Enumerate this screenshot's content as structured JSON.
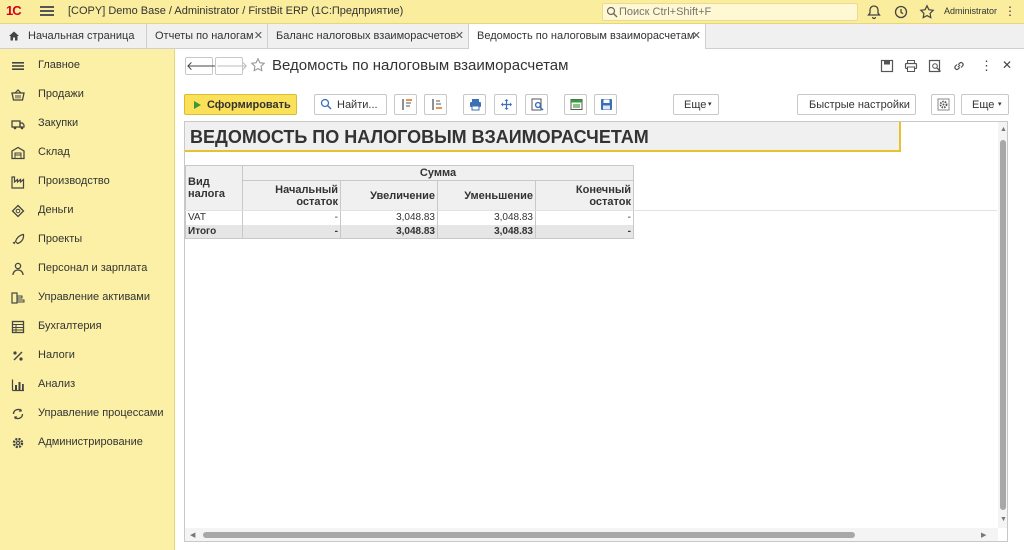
{
  "app": {
    "logo": "1С",
    "title": "[COPY] Demo Base / Administrator / FirstBit ERP  (1С:Предприятие)",
    "search_placeholder": "Поиск Ctrl+Shift+F",
    "user": "Administrator"
  },
  "tabs": [
    {
      "label": "Начальная страница",
      "closable": false
    },
    {
      "label": "Отчеты по налогам",
      "closable": true
    },
    {
      "label": "Баланс налоговых взаиморасчетов",
      "closable": true
    },
    {
      "label": "Ведомость по налоговым взаиморасчетам",
      "closable": true,
      "active": true
    }
  ],
  "sidebar": {
    "items": [
      {
        "label": "Главное",
        "icon": "menu-lines-icon"
      },
      {
        "label": "Продажи",
        "icon": "basket-icon"
      },
      {
        "label": "Закупки",
        "icon": "truck-icon"
      },
      {
        "label": "Склад",
        "icon": "warehouse-icon"
      },
      {
        "label": "Производство",
        "icon": "factory-icon"
      },
      {
        "label": "Деньги",
        "icon": "coins-icon"
      },
      {
        "label": "Проекты",
        "icon": "rocket-icon"
      },
      {
        "label": "Персонал и зарплата",
        "icon": "person-icon"
      },
      {
        "label": "Управление активами",
        "icon": "assets-icon"
      },
      {
        "label": "Бухгалтерия",
        "icon": "ledger-icon"
      },
      {
        "label": "Налоги",
        "icon": "percent-icon"
      },
      {
        "label": "Анализ",
        "icon": "bar-chart-icon"
      },
      {
        "label": "Управление процессами",
        "icon": "process-icon"
      },
      {
        "label": "Администрирование",
        "icon": "gear-icon"
      }
    ]
  },
  "form": {
    "title": "Ведомость по налоговым взаиморасчетам"
  },
  "toolbar": {
    "generate_label": "Сформировать",
    "find_label": "Найти...",
    "more_label": "Еще",
    "quick_settings_label": "Быстрые настройки",
    "more2_label": "Еще"
  },
  "report": {
    "heading": "ВЕДОМОСТЬ ПО НАЛОГОВЫМ ВЗАИМОРАСЧЕТАМ",
    "table": {
      "col_tax_type": "Вид налога",
      "group_header": "Сумма",
      "columns": [
        "Начальный остаток",
        "Увеличение",
        "Уменьшение",
        "Конечный остаток"
      ],
      "rows": [
        {
          "tax": "VAT",
          "opening": "-",
          "increase": "3,048.83",
          "decrease": "3,048.83",
          "closing": "-"
        }
      ],
      "total": {
        "label": "Итого",
        "opening": "-",
        "increase": "3,048.83",
        "decrease": "3,048.83",
        "closing": "-"
      }
    }
  }
}
